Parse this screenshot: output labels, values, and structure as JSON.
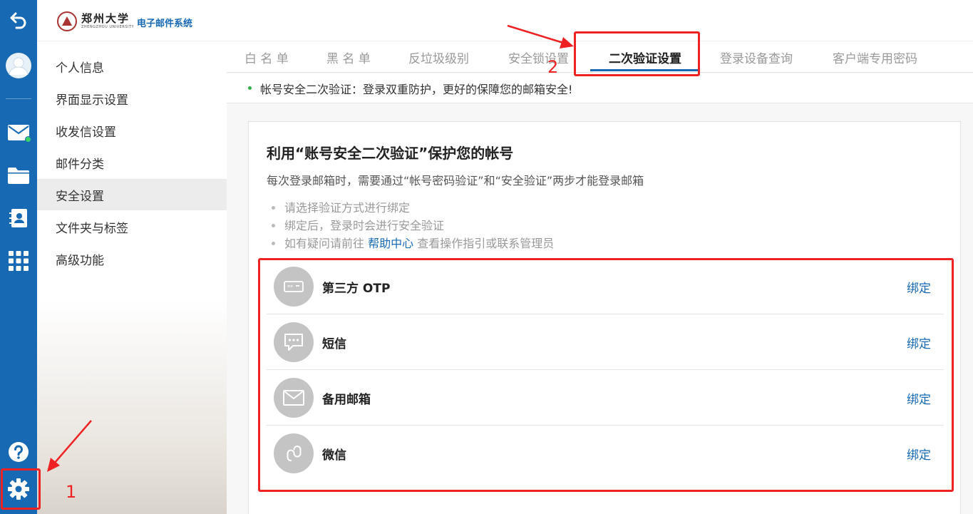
{
  "colors": {
    "rail": "#1769b3",
    "accent": "#1769b3",
    "annotation": "#ee2222",
    "online": "#3ad36a"
  },
  "header": {
    "logo_cn": "郑州大学",
    "logo_en": "ZHENGZHOU UNIVERSITY",
    "system_name": "电子邮件系统"
  },
  "rail": {
    "items": [
      {
        "name": "back-icon"
      },
      {
        "name": "avatar"
      },
      {
        "name": "mail-icon"
      },
      {
        "name": "folder-icon"
      },
      {
        "name": "contacts-icon"
      },
      {
        "name": "apps-grid-icon"
      },
      {
        "name": "help-icon"
      },
      {
        "name": "settings-gear-icon"
      }
    ]
  },
  "sidebar": {
    "items": [
      {
        "label": "个人信息"
      },
      {
        "label": "界面显示设置"
      },
      {
        "label": "收发信设置"
      },
      {
        "label": "邮件分类"
      },
      {
        "label": "安全设置",
        "active": true
      },
      {
        "label": "文件夹与标签"
      },
      {
        "label": "高级功能"
      }
    ]
  },
  "tabs": [
    {
      "label": "白 名 单"
    },
    {
      "label": "黑 名 单"
    },
    {
      "label": "反垃圾级别"
    },
    {
      "label": "安全锁设置"
    },
    {
      "label": "二次验证设置",
      "active": true
    },
    {
      "label": "登录设备查询"
    },
    {
      "label": "客户端专用密码"
    }
  ],
  "notice": "帐号安全二次验证：登录双重防护，更好的保障您的邮箱安全!",
  "card": {
    "title": "利用“账号安全二次验证”保护您的帐号",
    "desc": "每次登录邮箱时，需要通过“帐号密码验证”和“安全验证”两步才能登录邮箱",
    "tips": [
      "请选择验证方式进行绑定",
      "绑定后，登录时会进行安全验证"
    ],
    "tip3_pre": "如有疑问请前往 ",
    "tip3_link": "帮助中心",
    "tip3_post": " 查看操作指引或联系管理员",
    "methods": [
      {
        "label": "第三方 OTP",
        "icon": "otp-icon",
        "bind": "绑定"
      },
      {
        "label": "短信",
        "icon": "sms-icon",
        "bind": "绑定"
      },
      {
        "label": "备用邮箱",
        "icon": "envelope-icon",
        "bind": "绑定"
      },
      {
        "label": "微信",
        "icon": "wechat-icon",
        "bind": "绑定"
      }
    ]
  },
  "annotations": {
    "num1": "1",
    "num2": "2"
  }
}
